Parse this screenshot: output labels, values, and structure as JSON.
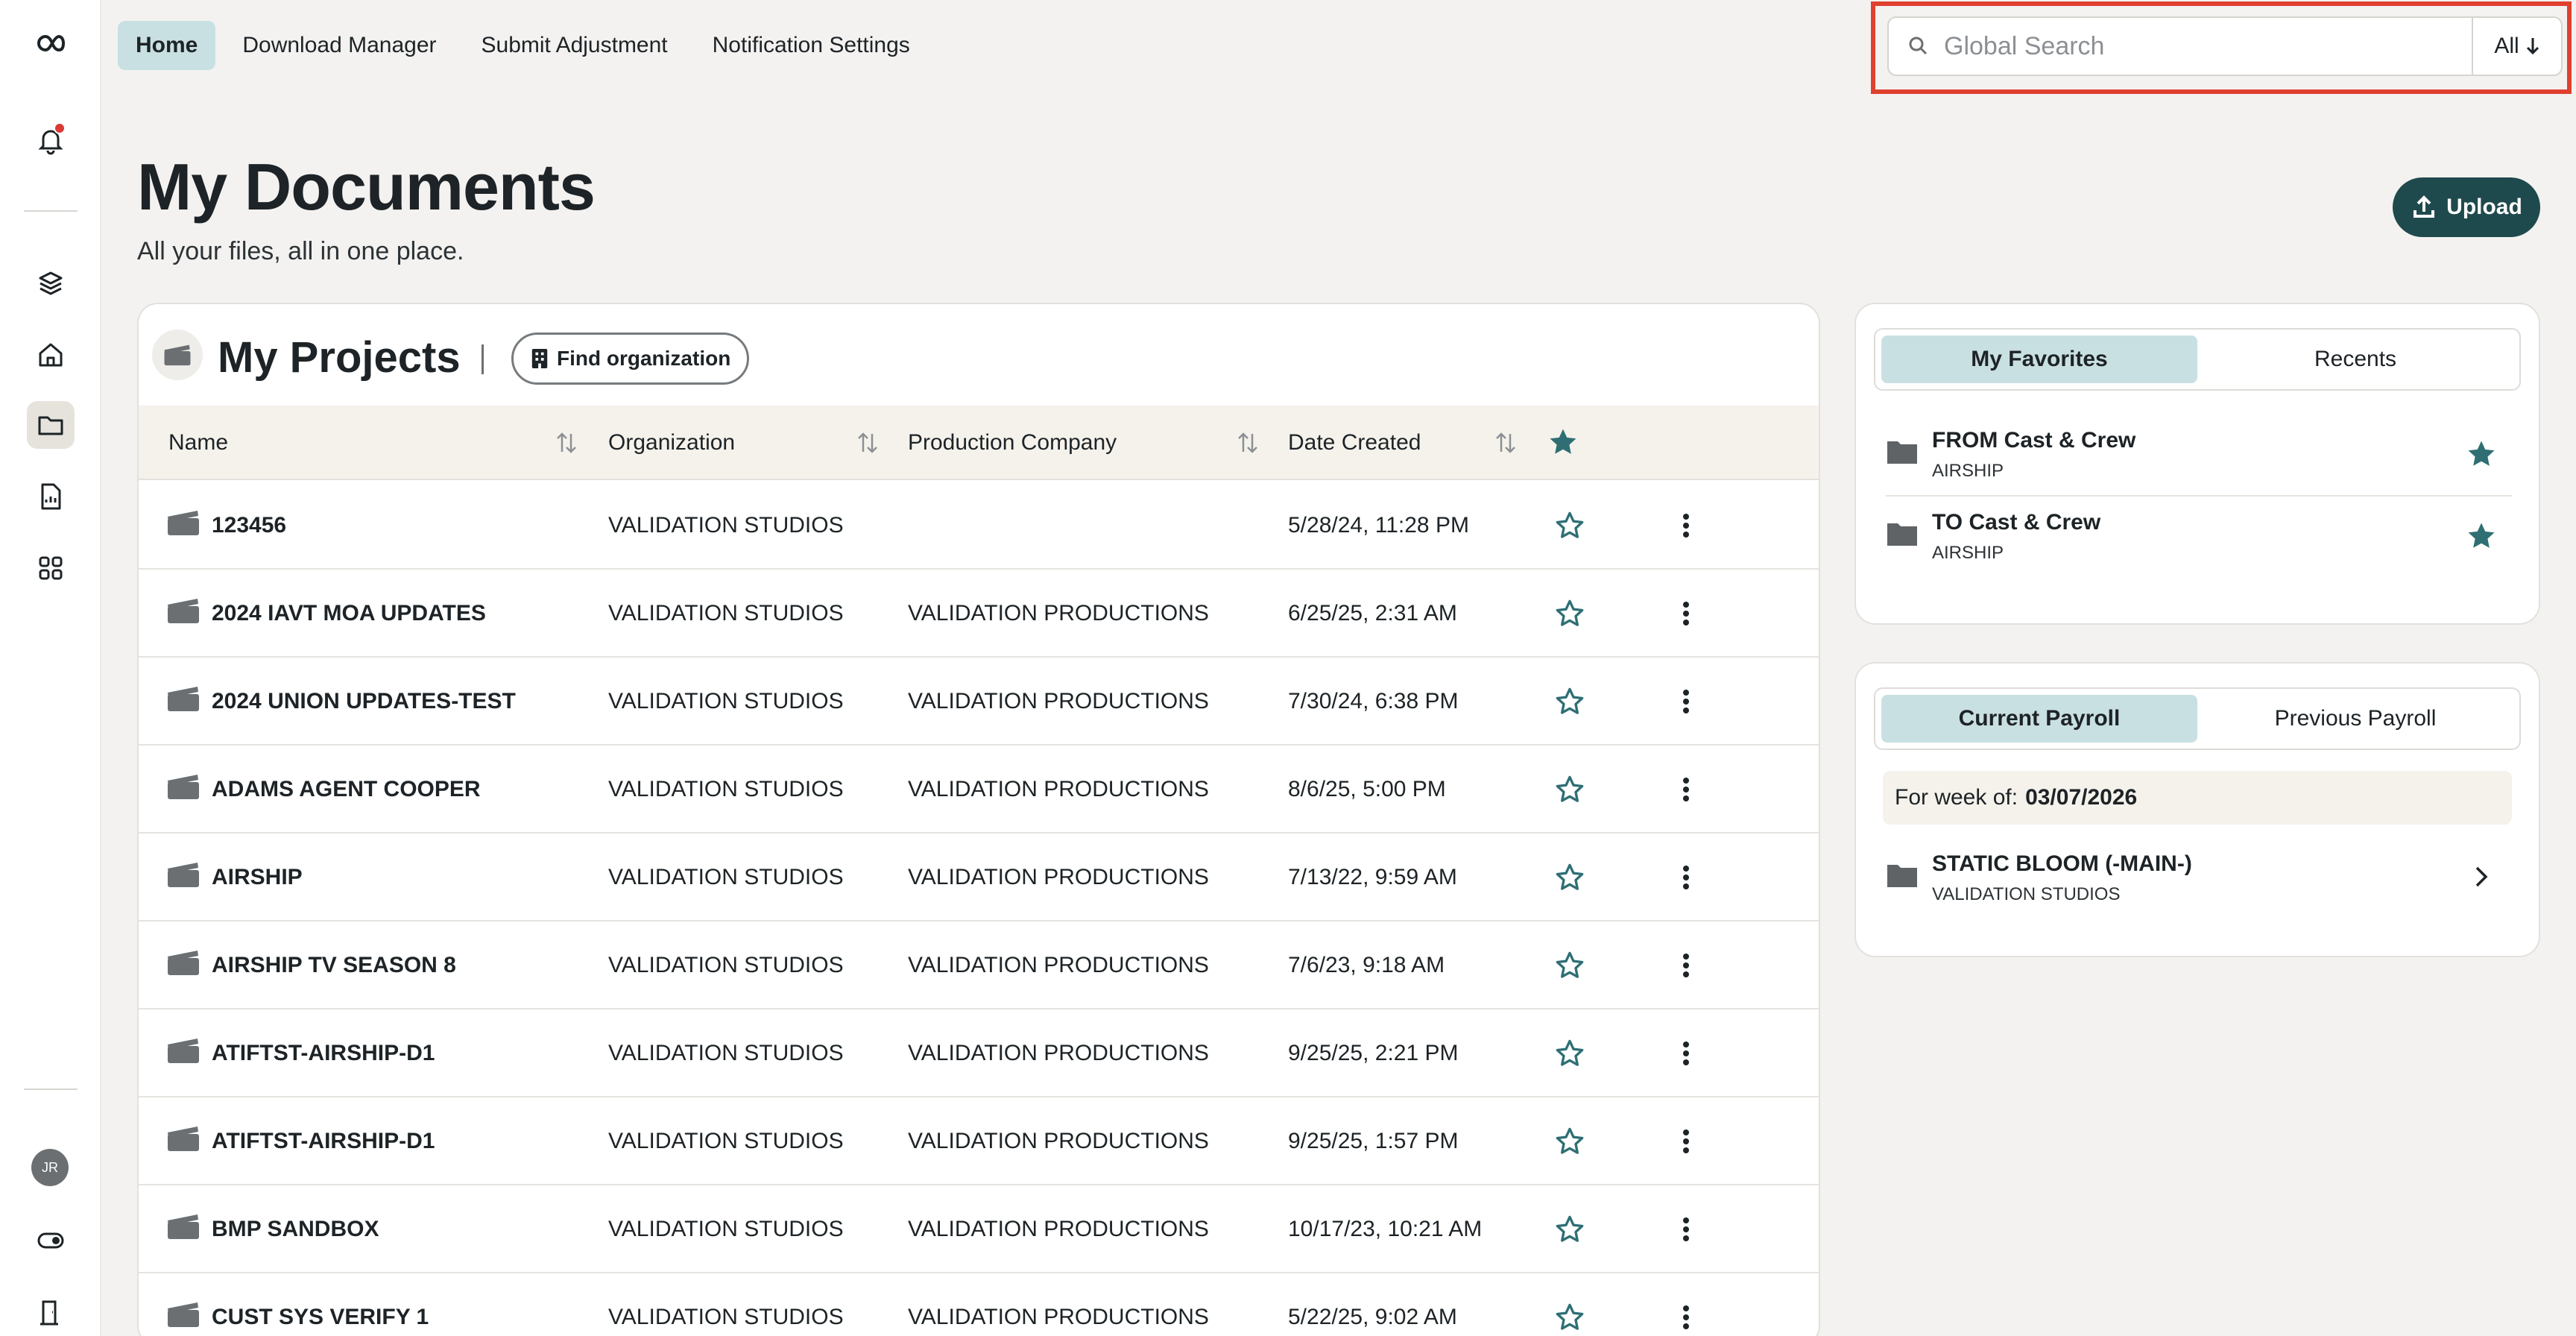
{
  "sidebar": {
    "icons": [
      "logo-icon",
      "bell-icon",
      "layers-icon",
      "home-icon",
      "folder-icon",
      "report-icon",
      "apps-grid-icon",
      "toggle-icon",
      "exit-door-icon"
    ],
    "avatar_initials": "JR"
  },
  "nav": {
    "tabs": [
      {
        "label": "Home",
        "active": true
      },
      {
        "label": "Download Manager"
      },
      {
        "label": "Submit Adjustment"
      },
      {
        "label": "Notification Settings"
      }
    ]
  },
  "search": {
    "placeholder": "Global Search",
    "value": "",
    "scope": "All"
  },
  "header": {
    "title": "My Documents",
    "subtitle": "All your files, all in one place.",
    "upload_label": "Upload"
  },
  "projects": {
    "title": "My Projects",
    "find_org_label": "Find organization",
    "columns": [
      "Name",
      "Organization",
      "Production Company",
      "Date Created"
    ],
    "rows": [
      {
        "name": "123456",
        "org": "VALIDATION STUDIOS",
        "prod": "",
        "date": "5/28/24, 11:28 PM"
      },
      {
        "name": "2024 IAVT MOA UPDATES",
        "org": "VALIDATION STUDIOS",
        "prod": "VALIDATION PRODUCTIONS",
        "date": "6/25/25, 2:31 AM"
      },
      {
        "name": "2024 UNION UPDATES-TEST",
        "org": "VALIDATION STUDIOS",
        "prod": "VALIDATION PRODUCTIONS",
        "date": "7/30/24, 6:38 PM"
      },
      {
        "name": "ADAMS AGENT COOPER",
        "org": "VALIDATION STUDIOS",
        "prod": "VALIDATION PRODUCTIONS",
        "date": "8/6/25, 5:00 PM"
      },
      {
        "name": "AIRSHIP",
        "org": "VALIDATION STUDIOS",
        "prod": "VALIDATION PRODUCTIONS",
        "date": "7/13/22, 9:59 AM"
      },
      {
        "name": "AIRSHIP TV SEASON 8",
        "org": "VALIDATION STUDIOS",
        "prod": "VALIDATION PRODUCTIONS",
        "date": "7/6/23, 9:18 AM"
      },
      {
        "name": "ATIFTST-AIRSHIP-D1",
        "org": "VALIDATION STUDIOS",
        "prod": "VALIDATION PRODUCTIONS",
        "date": "9/25/25, 2:21 PM"
      },
      {
        "name": "ATIFTST-AIRSHIP-D1",
        "org": "VALIDATION STUDIOS",
        "prod": "VALIDATION PRODUCTIONS",
        "date": "9/25/25, 1:57 PM"
      },
      {
        "name": "BMP SANDBOX",
        "org": "VALIDATION STUDIOS",
        "prod": "VALIDATION PRODUCTIONS",
        "date": "10/17/23, 10:21 AM"
      },
      {
        "name": "CUST SYS VERIFY 1",
        "org": "VALIDATION STUDIOS",
        "prod": "VALIDATION PRODUCTIONS",
        "date": "5/22/25, 9:02 AM"
      }
    ]
  },
  "favorites": {
    "tabs": [
      "My Favorites",
      "Recents"
    ],
    "items": [
      {
        "name": "FROM Cast & Crew",
        "org": "AIRSHIP"
      },
      {
        "name": "TO Cast & Crew",
        "org": "AIRSHIP"
      }
    ]
  },
  "payroll": {
    "tabs": [
      "Current Payroll",
      "Previous Payroll"
    ],
    "week_label": "For week of:",
    "week_date": "03/07/2026",
    "item": {
      "name": "STATIC BLOOM (-MAIN-)",
      "org": "VALIDATION STUDIOS"
    }
  },
  "colors": {
    "accent_teal": "#2f6f73",
    "active_tab_bg": "#c9e0e2",
    "upload_bg": "#1f4a4d",
    "highlight_red": "#e0402f"
  }
}
